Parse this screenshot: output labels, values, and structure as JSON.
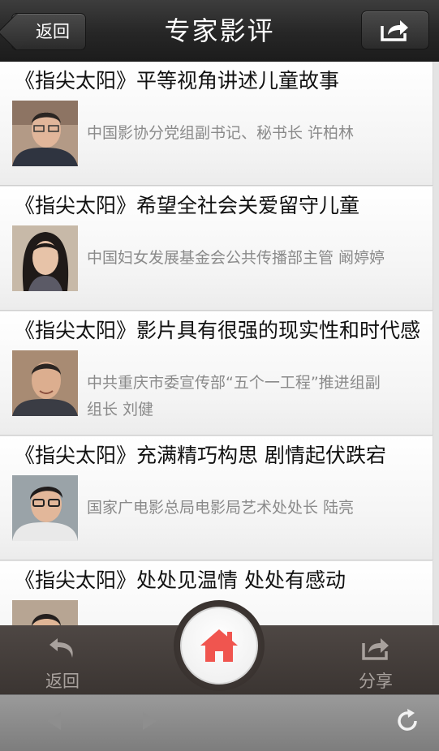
{
  "header": {
    "back_label": "返回",
    "title": "专家影评"
  },
  "articles": [
    {
      "title": "《指尖太阳》平等视角讲述儿童故事",
      "author": "中国影协分党组副书记、秘书长 许柏林"
    },
    {
      "title": "《指尖太阳》希望全社会关爱留守儿童",
      "author": "中国妇女发展基金会公共传播部主管 阚婷婷"
    },
    {
      "title": "《指尖太阳》影片具有很强的现实性和时代感",
      "author": "中共重庆市委宣传部“五个一工程”推进组副组长 刘健"
    },
    {
      "title": "《指尖太阳》充满精巧构思 剧情起伏跌宕",
      "author": "国家广电影总局电影局艺术处处长 陆亮"
    },
    {
      "title": "《指尖太阳》处处见温情 处处有感动",
      "author": ""
    }
  ],
  "bottom_bar": {
    "back_label": "返回",
    "share_label": "分享"
  },
  "colors": {
    "accent": "#f0554f",
    "topbar": "#262626",
    "actionbar": "#3f3835"
  },
  "icons": {
    "header_share": "share-arrow-icon",
    "home": "home-icon",
    "back": "curved-back-arrow-icon",
    "share": "share-arrow-icon",
    "browser_back": "triangle-left-icon",
    "browser_forward": "triangle-right-icon",
    "reload": "reload-icon"
  }
}
